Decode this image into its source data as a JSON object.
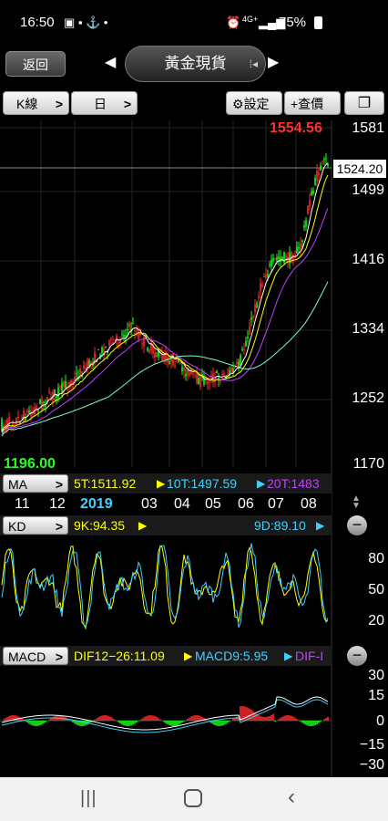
{
  "status_bar": {
    "time": "16:50",
    "network": "4G+",
    "battery": "75%"
  },
  "nav": {
    "back_label": "返回",
    "title": "黃金現貨"
  },
  "toolbar": {
    "chart_type": "K線",
    "period": "日",
    "settings_label": "設定",
    "query_label": "+查價"
  },
  "price_chart": {
    "high_label": "1554.56",
    "low_label": "1196.00",
    "current_price": "1524.20",
    "y_ticks": [
      "1581",
      "1499",
      "1416",
      "1334",
      "1252",
      "1170"
    ]
  },
  "ma_bar": {
    "button_label": "MA",
    "ma5": "5T:1511.92",
    "ma10": "10T:1497.59",
    "ma20": "20T:1483"
  },
  "time_axis": {
    "labels": [
      "11",
      "12",
      "2019",
      "03",
      "04",
      "05",
      "06",
      "07",
      "08"
    ]
  },
  "kd": {
    "button_label": "KD",
    "k_value": "9K:94.35",
    "d_value": "9D:89.10",
    "y_ticks": [
      "80",
      "50",
      "20"
    ]
  },
  "macd": {
    "button_label": "MACD",
    "dif": "DIF12−26:11.09",
    "macd": "MACD9:5.95",
    "dif_minus": "DIF-I",
    "y_ticks": [
      "30",
      "15",
      "0",
      "−15",
      "−30"
    ]
  },
  "colors": {
    "up": "#ff2a2a",
    "down": "#1aff1a",
    "ma5": "#ffffff",
    "ma10": "#ffff00",
    "ma20": "#c040ff",
    "long": "#7affc0",
    "kd_k": "#ffff00",
    "kd_d": "#40d0ff",
    "macd_dif": "#ffffff",
    "macd_line": "#40d0ff"
  }
}
